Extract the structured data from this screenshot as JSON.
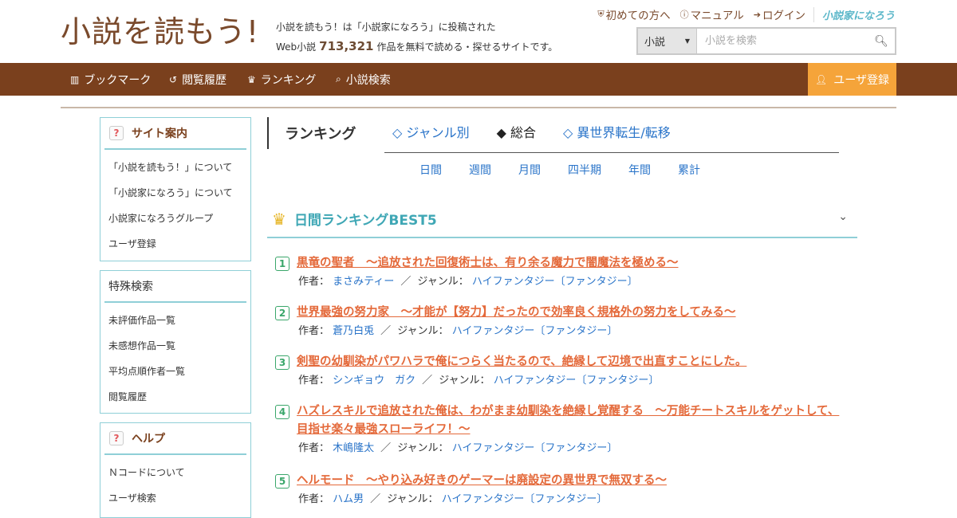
{
  "header": {
    "logo_text": "小説を読もう!",
    "tagline_line1": "小説を読もう！は「小説家になろう」に投稿された",
    "tagline_prefix": "Web小説",
    "tagline_count": "713,321",
    "tagline_suffix": "作品を無料で読める・探せるサイトです。",
    "toplinks": [
      {
        "label": "初めての方へ",
        "icon": "shield-icon"
      },
      {
        "label": "マニュアル",
        "icon": "question-circle-icon"
      },
      {
        "label": "ログイン",
        "icon": "login-icon"
      }
    ],
    "narou_logo_text": "小説家になろう",
    "search": {
      "select_value": "小説",
      "placeholder": "小説を検索"
    }
  },
  "nav": {
    "items": [
      {
        "label": "ブックマーク",
        "icon": "bookmark-icon"
      },
      {
        "label": "閲覧履歴",
        "icon": "history-icon"
      },
      {
        "label": "ランキング",
        "icon": "crown-icon"
      },
      {
        "label": "小説検索",
        "icon": "search-icon"
      }
    ],
    "register_label": "ユーザ登録",
    "register_icon": "user-icon"
  },
  "sidebar": {
    "site_guide": {
      "title": "サイト案内",
      "items": [
        "「小説を読もう！」について",
        "「小説家になろう」について",
        "小説家になろうグループ",
        "ユーザ登録"
      ]
    },
    "special_search": {
      "title": "特殊検索",
      "items": [
        "未評価作品一覧",
        "未感想作品一覧",
        "平均点順作者一覧",
        "閲覧履歴"
      ]
    },
    "help": {
      "title": "ヘルプ",
      "items": [
        "Ｎコードについて",
        "ユーザ検索"
      ]
    }
  },
  "ranking": {
    "title": "ランキング",
    "tabs": [
      "◇ ジャンル別",
      "◆ 総合",
      "◇ 異世界転生/転移"
    ],
    "active_tab": 1,
    "periods": [
      "日間",
      "週間",
      "月間",
      "四半期",
      "年間",
      "累計"
    ],
    "best5_title": "日間ランキングBEST5",
    "author_label": "作者：",
    "genre_label": "ジャンル：",
    "entries": [
      {
        "rank": "1",
        "title": "黒竜の聖者　～追放された回復術士は、有り余る魔力で闇魔法を極める～",
        "author": "まさみティー",
        "genre": "ハイファンタジー〔ファンタジー〕"
      },
      {
        "rank": "2",
        "title": "世界最強の努力家　～才能が【努力】だったので効率良く規格外の努力をしてみる～",
        "author": "蒼乃白兎",
        "genre": "ハイファンタジー〔ファンタジー〕"
      },
      {
        "rank": "3",
        "title": "剣聖の幼馴染がパワハラで俺につらく当たるので、絶縁して辺境で出直すことにした。",
        "author": "シンギョウ　ガク",
        "genre": "ハイファンタジー〔ファンタジー〕"
      },
      {
        "rank": "4",
        "title": "ハズレスキルで追放された俺は、わがまま幼馴染を絶縁し覚醒する　～万能チートスキルをゲットして、目指せ楽々最強スローライフ！～",
        "author": "木嶋隆太",
        "genre": "ハイファンタジー〔ファンタジー〕"
      },
      {
        "rank": "5",
        "title": "ヘルモード　～やり込み好きのゲーマーは廃設定の異世界で無双する～",
        "author": "ハム男",
        "genre": "ハイファンタジー〔ファンタジー〕"
      }
    ]
  }
}
